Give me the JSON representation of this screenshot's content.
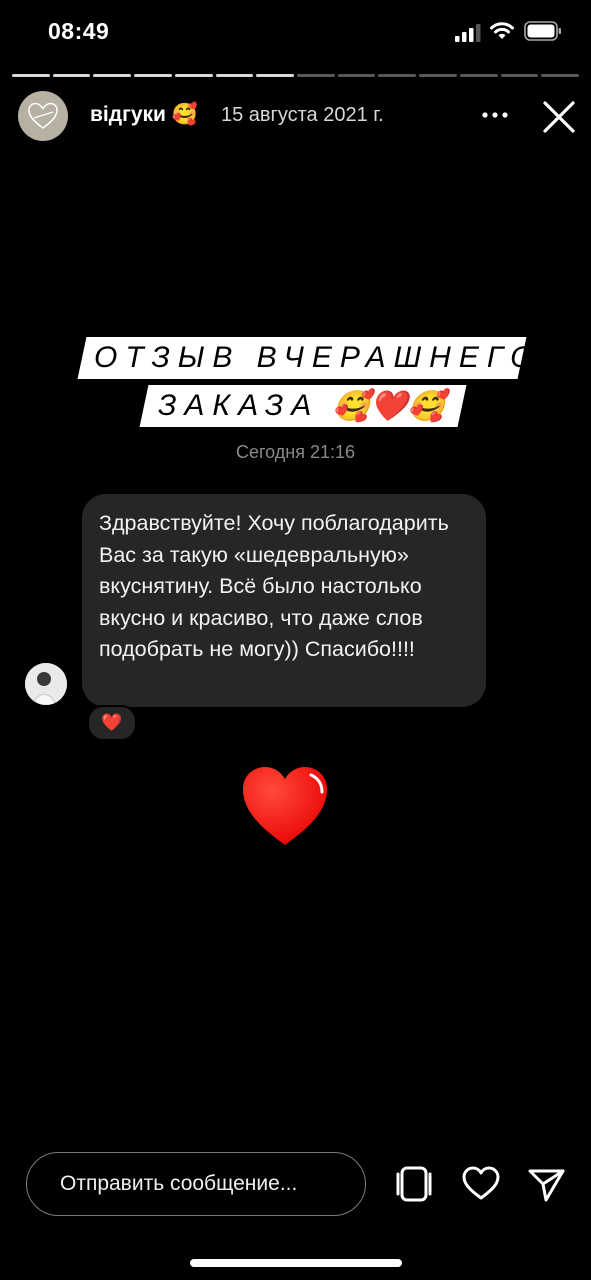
{
  "status_bar": {
    "time": "08:49"
  },
  "story": {
    "progress": {
      "segments": 14,
      "completed": 7
    },
    "author": "відгуки 🥰",
    "date": "15 августа 2021 г.",
    "title_line1": "ОТЗЫВ  ВЧЕРАШНЕГО",
    "title_line2": "ЗАКАЗА",
    "title_emoji": "🥰❤️🥰",
    "message_time": "Сегодня 21:16",
    "message_text": "Здравствуйте! Хочу поблагодарить Вас за такую «шедевральную» вкуснятину. Всё было настолько вкусно и красиво, что даже слов подобрать не могу)) Спасибо!!!!",
    "reaction": "❤️"
  },
  "footer": {
    "reply_placeholder": "Отправить сообщение..."
  },
  "colors": {
    "background": "#000000",
    "bubble": "#262626",
    "heart": "#ff1a1a"
  }
}
